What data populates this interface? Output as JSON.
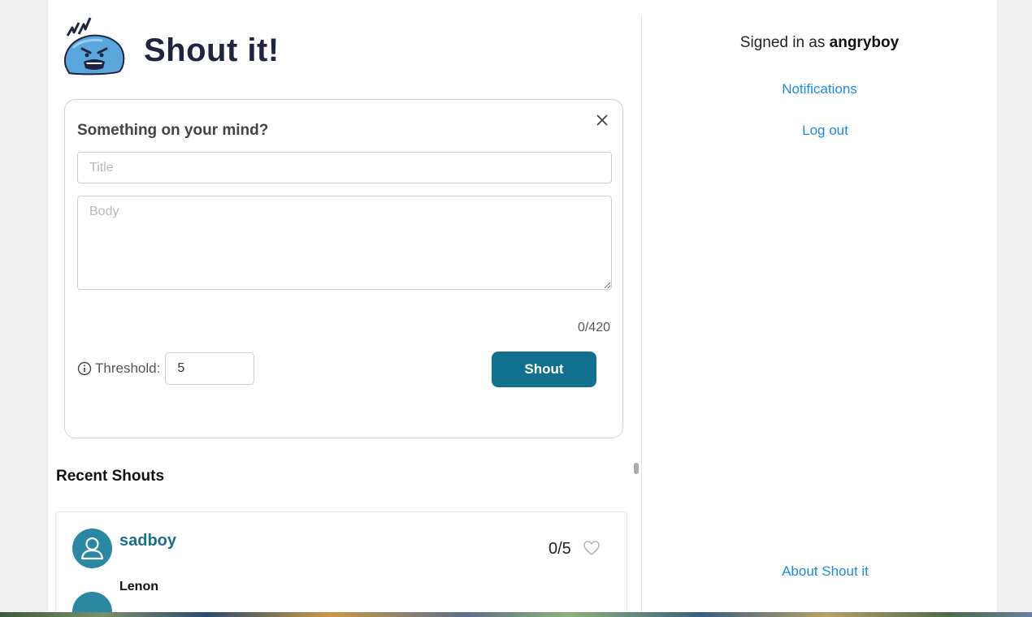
{
  "app": {
    "title": "Shout it!",
    "logo_icon": "angry-blob-logo"
  },
  "compose": {
    "heading": "Something on your mind?",
    "title_placeholder": "Title",
    "title_value": "",
    "body_placeholder": "Body",
    "body_value": "",
    "char_count": "0/420",
    "threshold_label": "Threshold:",
    "threshold_value": "5",
    "submit_label": "Shout",
    "accent_color": "#12708f"
  },
  "recent": {
    "heading": "Recent Shouts",
    "items": [
      {
        "author": "sadboy",
        "score": "0/5",
        "title": "Lenon"
      }
    ]
  },
  "sidebar": {
    "signed_in_prefix": "Signed in as",
    "username": "angryboy",
    "links": {
      "notifications": "Notifications",
      "logout": "Log out",
      "about": "About Shout it"
    },
    "link_color": "#1a8be0"
  }
}
